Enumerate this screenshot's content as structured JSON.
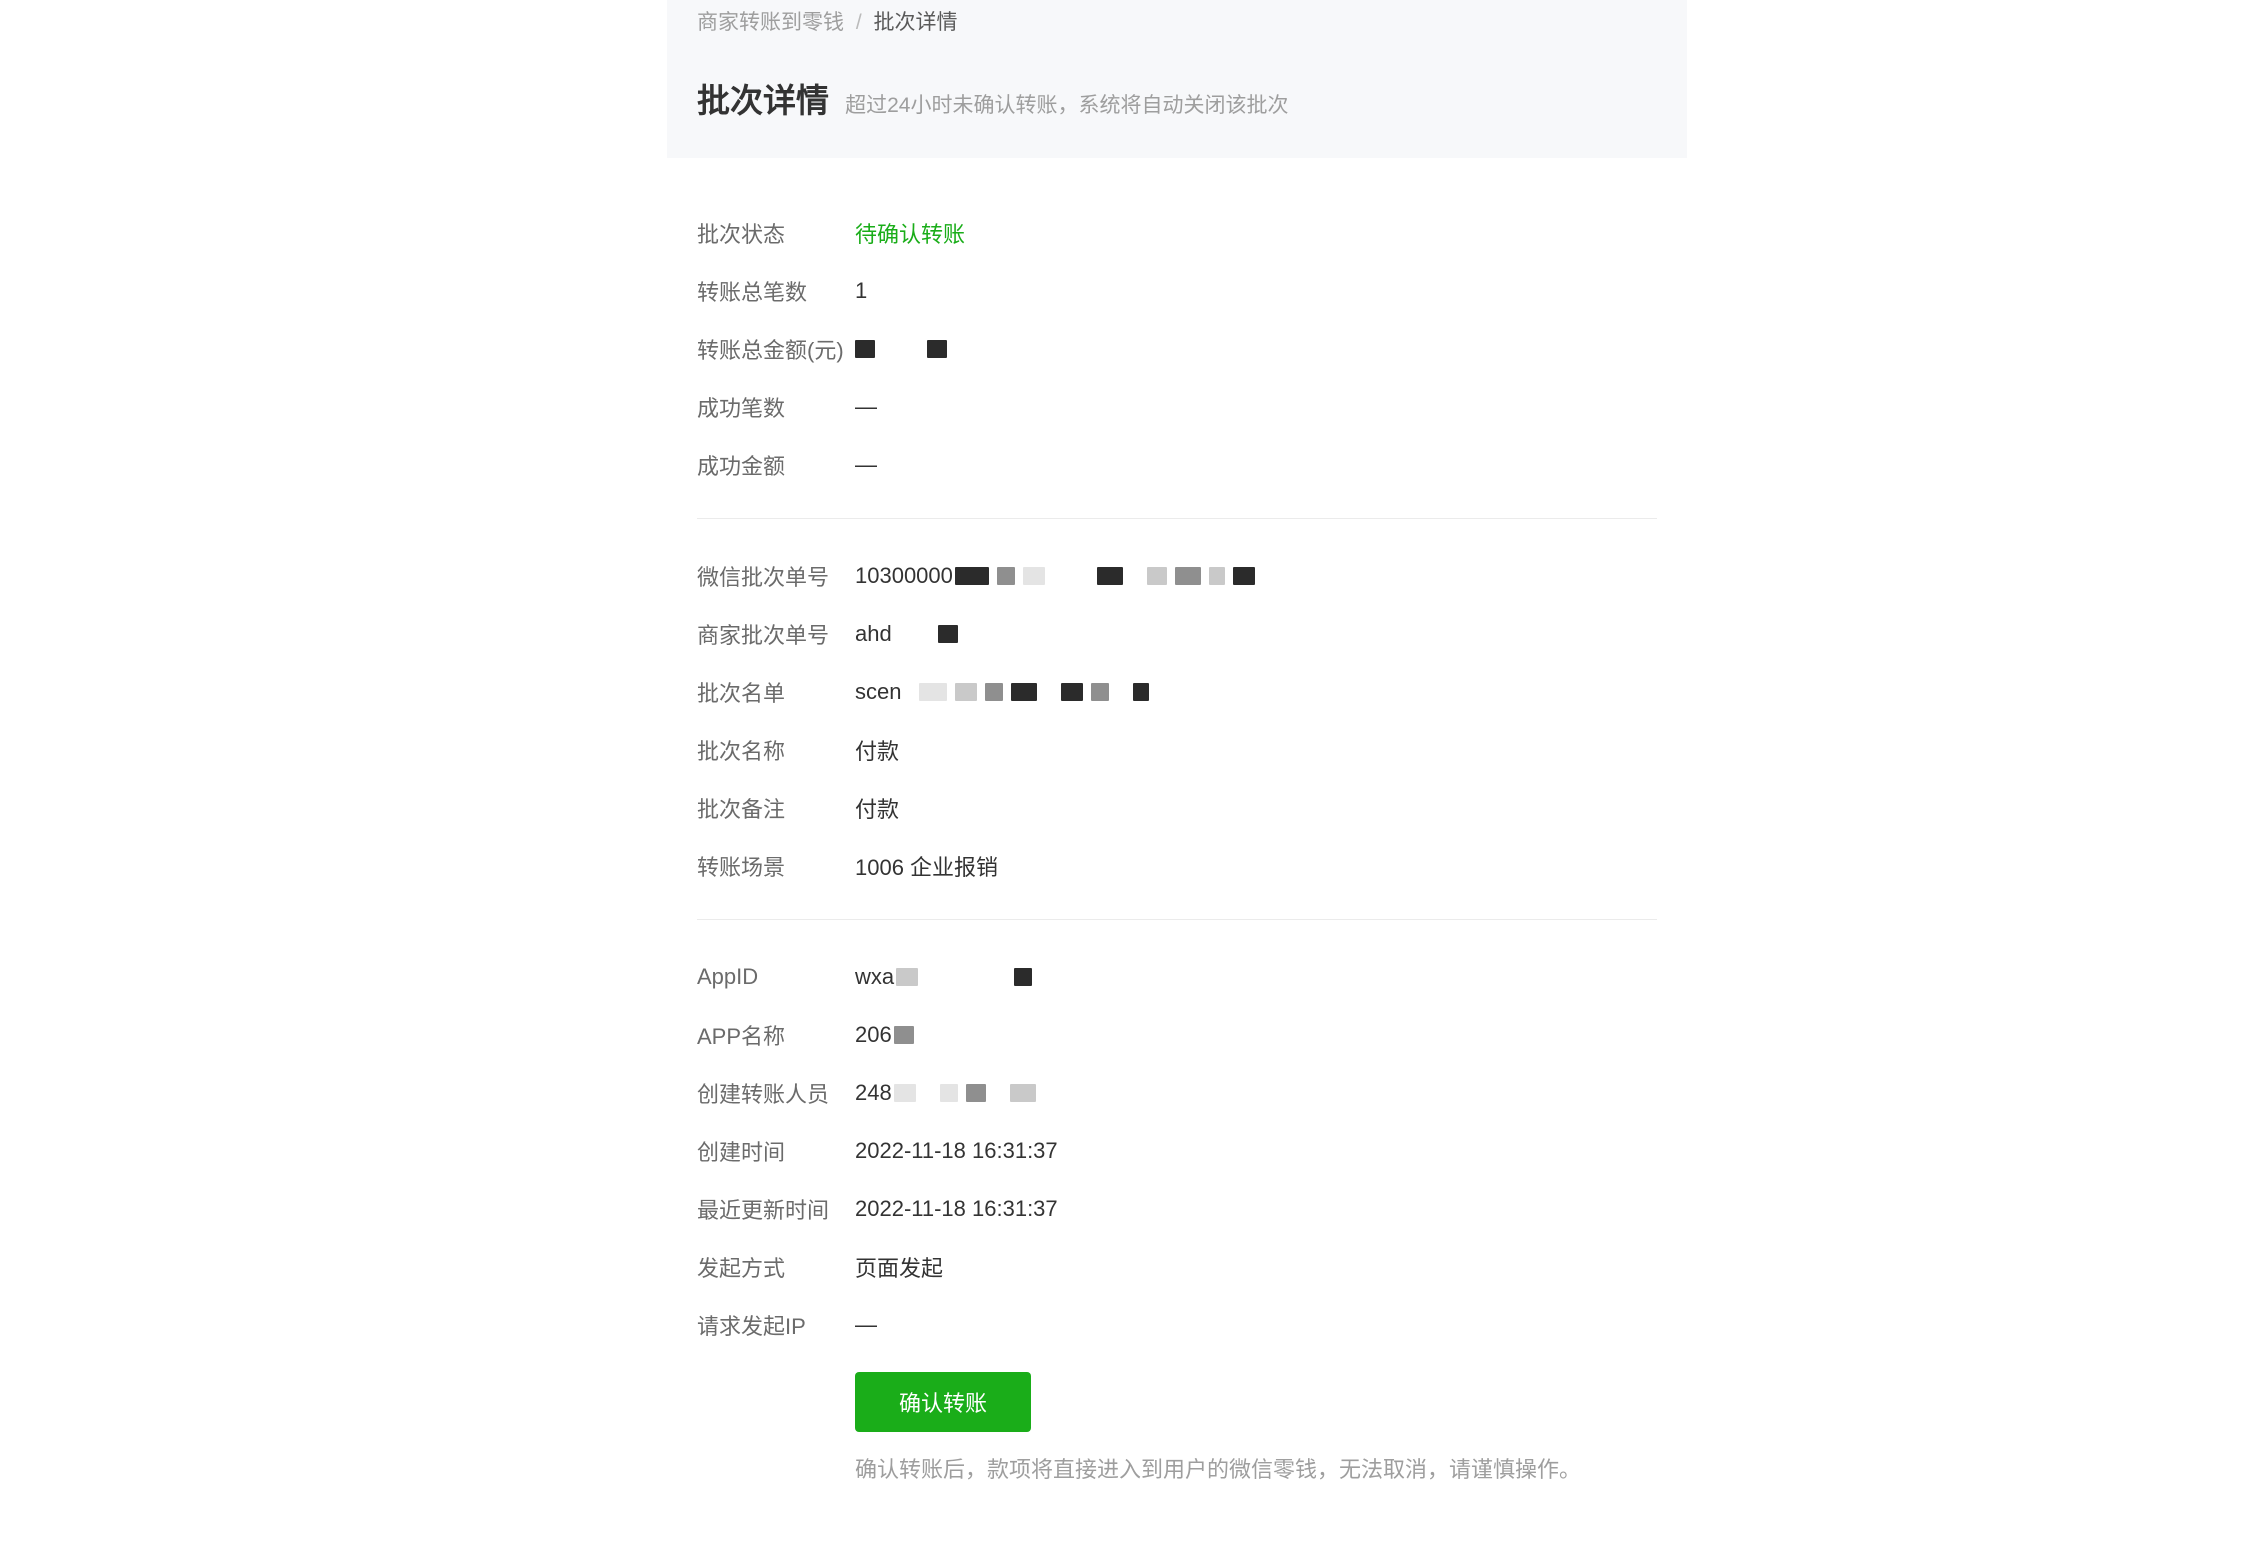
{
  "breadcrumb": {
    "parent": "商家转账到零钱",
    "current": "批次详情"
  },
  "header": {
    "title": "批次详情",
    "subtitle": "超过24小时未确认转账，系统将自动关闭该批次"
  },
  "labels": {
    "batch_status": "批次状态",
    "total_count": "转账总笔数",
    "total_amount": "转账总金额(元)",
    "success_count": "成功笔数",
    "success_amount": "成功金额",
    "wx_batch_no": "微信批次单号",
    "mch_batch_no": "商家批次单号",
    "batch_list": "批次名单",
    "batch_name": "批次名称",
    "batch_remark": "批次备注",
    "transfer_scene": "转账场景",
    "app_id": "AppID",
    "app_name": "APP名称",
    "creator": "创建转账人员",
    "create_time": "创建时间",
    "update_time": "最近更新时间",
    "initiate_method": "发起方式",
    "request_ip": "请求发起IP"
  },
  "values": {
    "batch_status": "待确认转账",
    "total_count": "1",
    "success_count": "—",
    "success_amount": "—",
    "wx_batch_no_prefix": "10300000",
    "mch_batch_no_prefix": "ahd",
    "batch_list_prefix": "scen",
    "batch_name": "付款",
    "batch_remark": "付款",
    "transfer_scene": "1006 企业报销",
    "app_id_prefix": "wxa",
    "app_name_prefix": "206",
    "creator_prefix": "248",
    "create_time": "2022-11-18 16:31:37",
    "update_time": "2022-11-18 16:31:37",
    "initiate_method": "页面发起",
    "request_ip": "—"
  },
  "action": {
    "confirm_label": "确认转账",
    "confirm_note": "确认转账后，款项将直接进入到用户的微信零钱，无法取消，请谨慎操作。"
  }
}
